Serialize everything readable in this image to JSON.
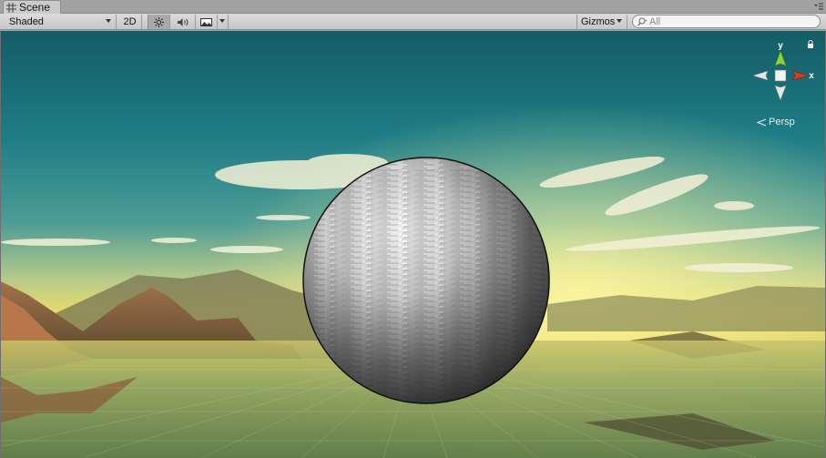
{
  "tab": {
    "label": "Scene",
    "icon": "grid-icon"
  },
  "toolbar": {
    "shading_mode": "Shaded",
    "mode_2d": "2D",
    "lighting_icon": "sun-icon",
    "audio_icon": "speaker-icon",
    "effects_icon": "image-icon",
    "gizmos_label": "Gizmos",
    "search_placeholder": "All"
  },
  "scene_gizmo": {
    "axis_y": "y",
    "axis_x": "x",
    "projection_label": "Persp",
    "colors": {
      "y": "#8cd13b",
      "x": "#d9391e",
      "neutral": "#e5e5e5"
    }
  },
  "viewport": {
    "object": "sphere",
    "sky_top": "#17636d",
    "horizon": "#e8dc5e"
  }
}
